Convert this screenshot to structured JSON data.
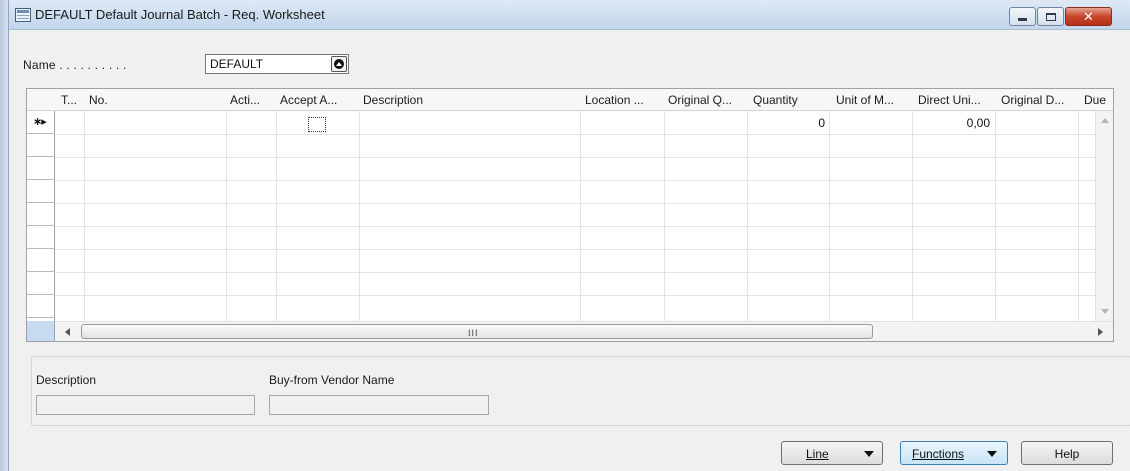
{
  "window": {
    "title": "DEFAULT Default Journal Batch - Req. Worksheet",
    "minimize_glyph": "",
    "close_glyph": "✕",
    "icons": {
      "app": "worksheet-icon",
      "lookup": "lookup-up-icon"
    }
  },
  "header": {
    "name_label": "Name . . . . . . . . . .",
    "name_value": "DEFAULT"
  },
  "grid": {
    "columns": [
      "T...",
      "No.",
      "Acti...",
      "Accept A...",
      "Description",
      "Location ...",
      "Original Q...",
      "Quantity",
      "Unit of M...",
      "Direct Uni...",
      "Original D...",
      "Due"
    ],
    "new_row_marker": "∗▸",
    "rows": [
      {
        "quantity": "0",
        "direct_unit_cost": "0,00",
        "accept": false
      }
    ],
    "hscroll_grip": "III"
  },
  "details": {
    "description_label": "Description",
    "description_value": "",
    "vendor_label": "Buy-from Vendor Name",
    "vendor_value": ""
  },
  "buttons": {
    "line": "Line",
    "functions": "Functions",
    "help": "Help"
  },
  "colors": {
    "titlebar": "#c3d6ec",
    "close_button": "#c7452a",
    "selector_corner": "#c8daf0",
    "focused_button": "#c7e4f7"
  }
}
